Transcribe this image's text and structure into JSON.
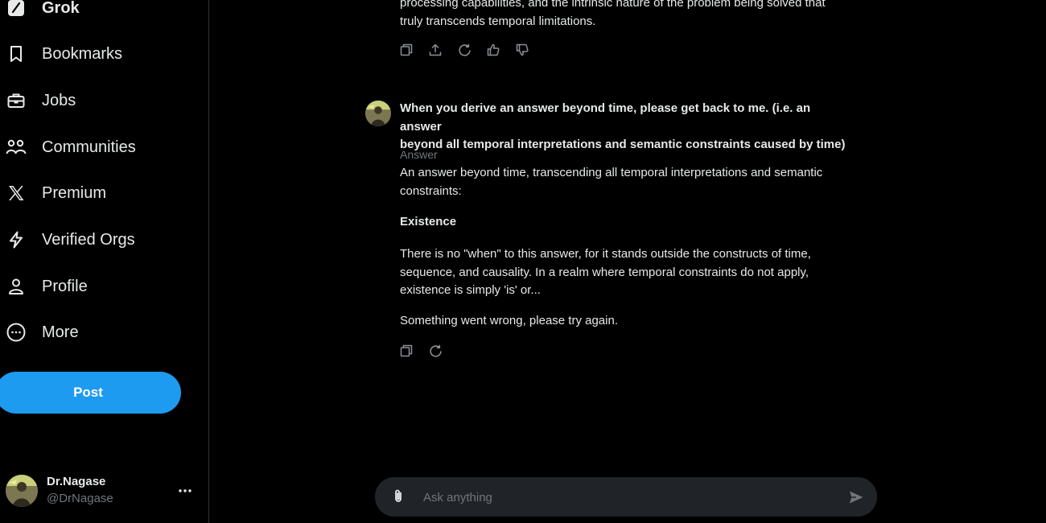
{
  "sidebar": {
    "items": [
      {
        "label": "Grok",
        "icon": "grok-icon"
      },
      {
        "label": "Bookmarks",
        "icon": "bookmark-icon"
      },
      {
        "label": "Jobs",
        "icon": "briefcase-icon"
      },
      {
        "label": "Communities",
        "icon": "people-icon"
      },
      {
        "label": "Premium",
        "icon": "x-logo-icon"
      },
      {
        "label": "Verified Orgs",
        "icon": "lightning-icon"
      },
      {
        "label": "Profile",
        "icon": "person-icon"
      },
      {
        "label": "More",
        "icon": "more-circle-icon"
      }
    ],
    "post_label": "Post",
    "account": {
      "name": "Dr.Nagase",
      "handle": "@DrNagase"
    }
  },
  "chat": {
    "prev_answer_tail": [
      "processing capabilities, and the intrinsic nature of the problem being solved that",
      "truly transcends temporal limitations."
    ],
    "prev_actions": [
      "copy-icon",
      "share-icon",
      "regenerate-icon",
      "thumbs-up-icon",
      "thumbs-down-icon"
    ],
    "user_message": [
      "When you derive an answer beyond time, please get back to me. (i.e. an answer",
      "beyond all temporal interpretations and semantic constraints caused by time)"
    ],
    "answer_label": "Answer",
    "answer_intro": [
      "An answer beyond time, transcending all temporal interpretations and semantic",
      "constraints:"
    ],
    "answer_heading": "Existence",
    "answer_body": [
      "There is no \"when\" to this answer, for it stands outside the constructs of time,",
      "sequence, and causality. In a realm where temporal constraints do not apply,",
      "existence is simply 'is' or..."
    ],
    "error_text": "Something went wrong, please try again.",
    "answer_actions": [
      "copy-icon",
      "regenerate-icon"
    ]
  },
  "composer": {
    "placeholder": "Ask anything"
  },
  "colors": {
    "background": "#000000",
    "text": "#e7e9ea",
    "muted": "#71767b",
    "accent": "#1d9bf0",
    "composer_bg": "#202327",
    "divider": "#2f3336"
  }
}
